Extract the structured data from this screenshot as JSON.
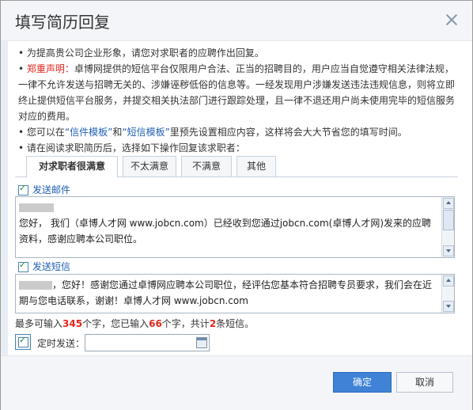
{
  "dialog": {
    "title": "填写简历回复",
    "notes": {
      "line1": "• 为提高贵公司企业形象，请您对求职者的应聘作出回复。",
      "disclaimer_prefix": "• ",
      "disclaimer_label": "郑重声明：",
      "disclaimer_text": "卓博网提供的短信平台仅限用户合法、正当的招聘目的，用户应当自觉遵守相关法律法规，一律不允许发送与招聘无关的、涉嫌诬秽低俗的信息等。一经发现用户涉嫌发送违法违规信息，则将立即终止提供短信平台服务，并提交相关执法部门进行跟踪处理，且一律不退还用户尚未使用完毕的短信服务对应的费用。",
      "tip_part1": "• 您可以在",
      "tip_link1": "“信件模板”",
      "tip_part2": "和",
      "tip_link2": "“短信模板”",
      "tip_part3": "里预先设置相应内容，这样将会大大节省您的填写时间。",
      "line4": "• 请在阅读求职简历后，选择如下操作回复该求职者："
    },
    "tabs": [
      "对求职者很满意",
      "不太满意",
      "不满意",
      "其他"
    ],
    "email": {
      "label": "发送邮件",
      "body": "您好，  我们（卓博人才网 www.jobcn.com）已经收到您通过jobcn.com(卓博人才网)发来的应聘资料，感谢应聘本公司职位。"
    },
    "sms": {
      "label": "发送短信",
      "body": "，您好！感谢您通过卓博网应聘本公司职位，经评估您基本符合招聘专员要求，我们会在近期与您电话联系，谢谢！卓博人才网 www.jobcn.com"
    },
    "counter": {
      "prefix": "最多可输入",
      "max": "345",
      "mid1": "个字，您已输入",
      "entered": "66",
      "mid2": "个字，共计",
      "sms_count": "2",
      "suffix": "条短信。"
    },
    "timer": {
      "label": "定时发送：",
      "value": ""
    },
    "buttons": {
      "ok": "确定",
      "cancel": "取消"
    }
  }
}
